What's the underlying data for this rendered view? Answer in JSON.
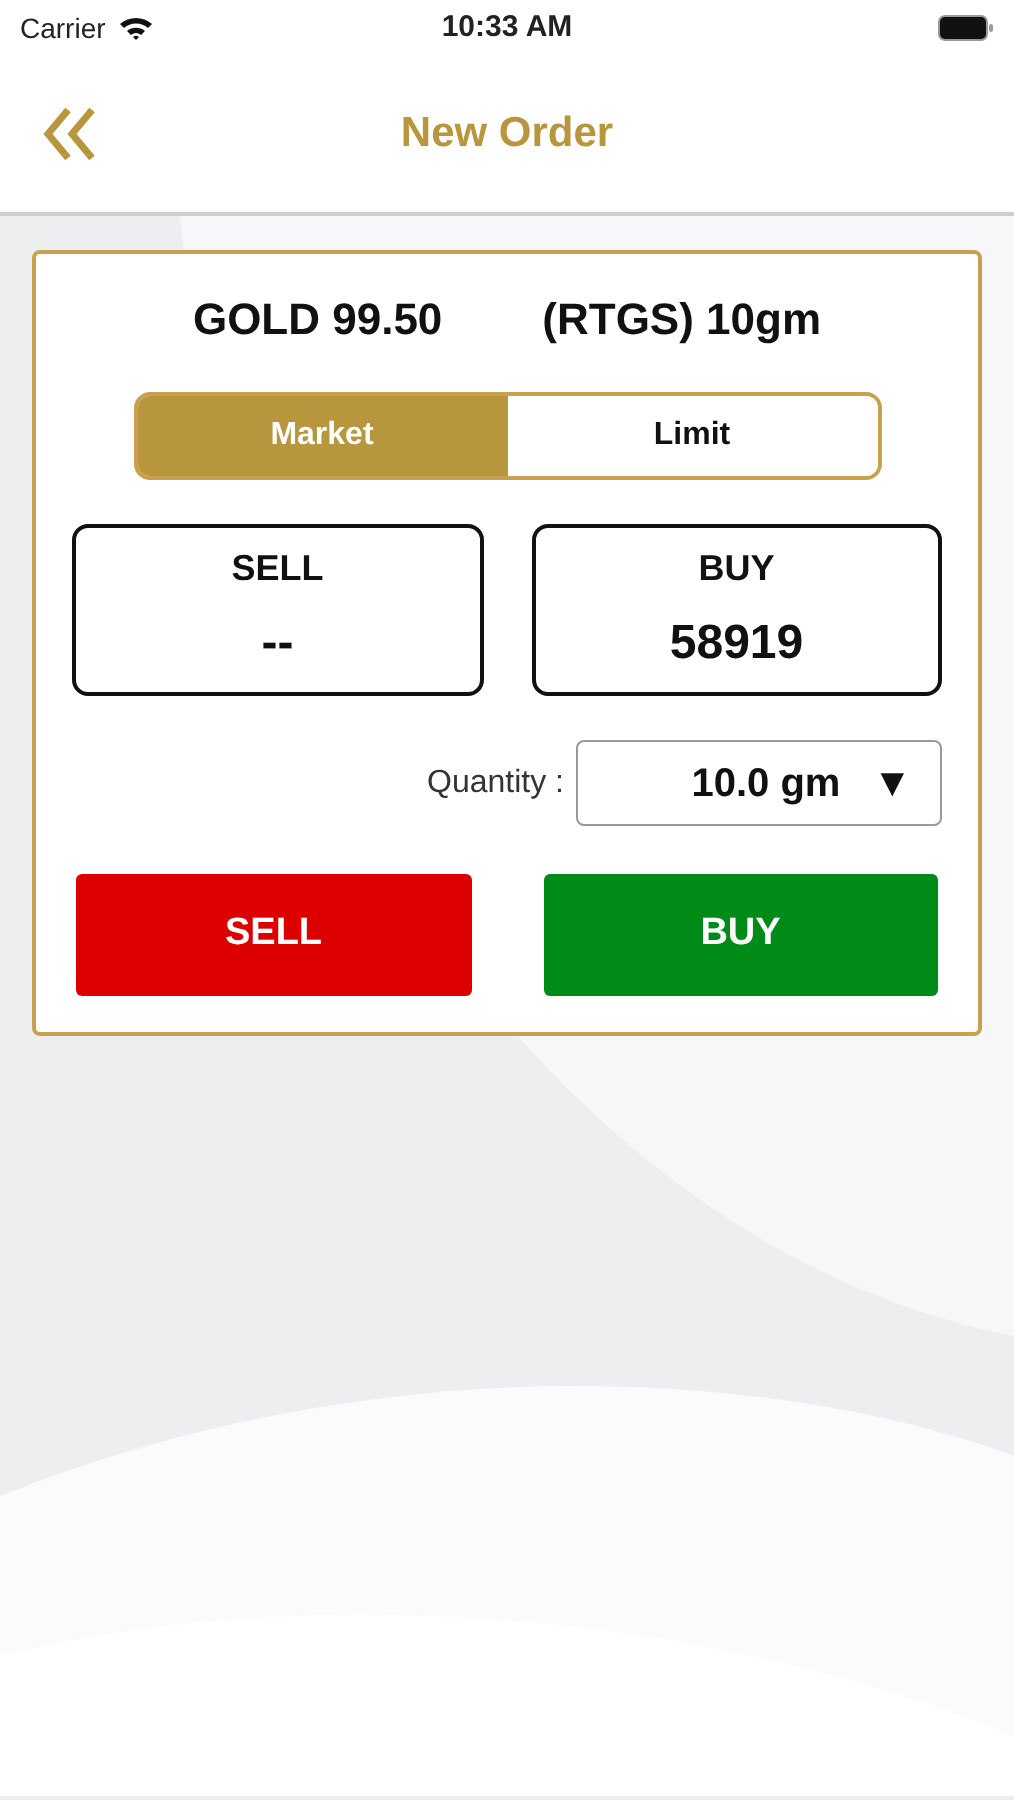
{
  "status_bar": {
    "carrier": "Carrier",
    "time": "10:33 AM"
  },
  "nav": {
    "title": "New Order"
  },
  "product": {
    "name": "GOLD 99.50",
    "contract": "(RTGS) 10gm"
  },
  "order_types": [
    {
      "label": "Market",
      "selected": true
    },
    {
      "label": "Limit",
      "selected": false
    }
  ],
  "quotes": [
    {
      "label": "SELL",
      "value": "--"
    },
    {
      "label": "BUY",
      "value": "58919"
    }
  ],
  "quantity": {
    "label": "Quantity :",
    "value": "10.0 gm",
    "caret": "▼"
  },
  "actions": [
    {
      "label": "SELL",
      "kind": "sell"
    },
    {
      "label": "BUY",
      "kind": "buy"
    }
  ]
}
